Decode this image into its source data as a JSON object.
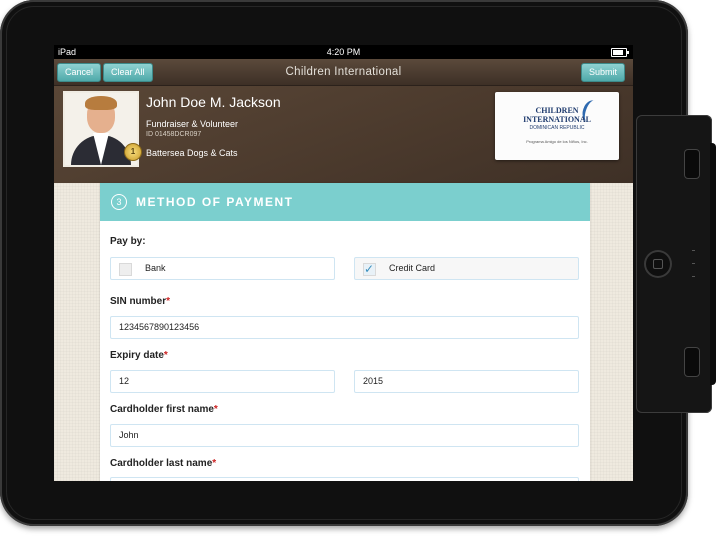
{
  "status_bar": {
    "carrier": "iPad",
    "time": "4:20 PM"
  },
  "nav": {
    "title": "Children International",
    "cancel": "Cancel",
    "clear_all": "Clear All",
    "submit": "Submit"
  },
  "profile": {
    "name": "John Doe M. Jackson",
    "role": "Fundraiser & Volunteer",
    "id_label": "ID",
    "id_value": "01458DCR097",
    "group": "Battersea Dogs & Cats",
    "badge": "1"
  },
  "logo": {
    "line1": "CHILDREN",
    "line2": "INTERNATIONAL",
    "line3": "DOMINICAN REPUBLIC",
    "line4": "Programa Amigo de los Niños, Inc."
  },
  "section": {
    "number": "3",
    "title": "METHOD OF PAYMENT"
  },
  "form": {
    "pay_by_label": "Pay by:",
    "options": [
      {
        "label": "Bank",
        "checked": false
      },
      {
        "label": "Credit Card",
        "checked": true
      }
    ],
    "sin_label": "SIN number",
    "sin_value": "1234567890123456",
    "expiry_label": "Expiry date",
    "expiry_month": "12",
    "expiry_year": "2015",
    "first_name_label": "Cardholder first name",
    "first_name_value": "John",
    "last_name_label": "Cardholder last name",
    "last_name_value": "",
    "required_mark": "*"
  }
}
